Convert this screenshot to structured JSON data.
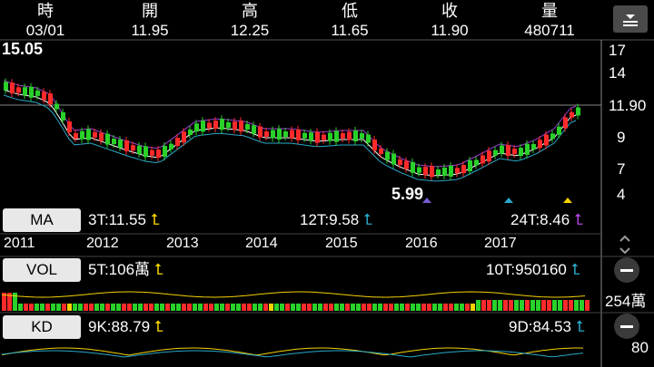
{
  "header": {
    "columns": [
      {
        "label": "時",
        "value": "03/01"
      },
      {
        "label": "開",
        "value": "11.95"
      },
      {
        "label": "高",
        "value": "12.25"
      },
      {
        "label": "低",
        "value": "11.65"
      },
      {
        "label": "收",
        "value": "11.90"
      },
      {
        "label": "量",
        "value": "480711"
      }
    ]
  },
  "price_chart": {
    "high_mark": "15.05",
    "low_mark": "5.99",
    "last_price": "11.90",
    "axis_ticks": [
      "17",
      "14",
      "9",
      "7",
      "4"
    ]
  },
  "ma": {
    "label": "MA",
    "t3": "3T:11.55",
    "t12": "12T:9.58",
    "t24": "24T:8.46"
  },
  "years": [
    "2011",
    "2012",
    "2013",
    "2014",
    "2015",
    "2016",
    "2017"
  ],
  "vol": {
    "label": "VOL",
    "t5": "5T:106萬",
    "t10": "10T:950160",
    "axis": "254萬"
  },
  "kd": {
    "label": "KD",
    "k": "9K:88.79",
    "d": "9D:84.53",
    "axis": "80"
  },
  "colors": {
    "up": "#ff2a2a",
    "down": "#29d12a",
    "ma3": "#ffffff",
    "ma12": "#2aa8c8",
    "ma24": "#9b3fd0"
  }
}
